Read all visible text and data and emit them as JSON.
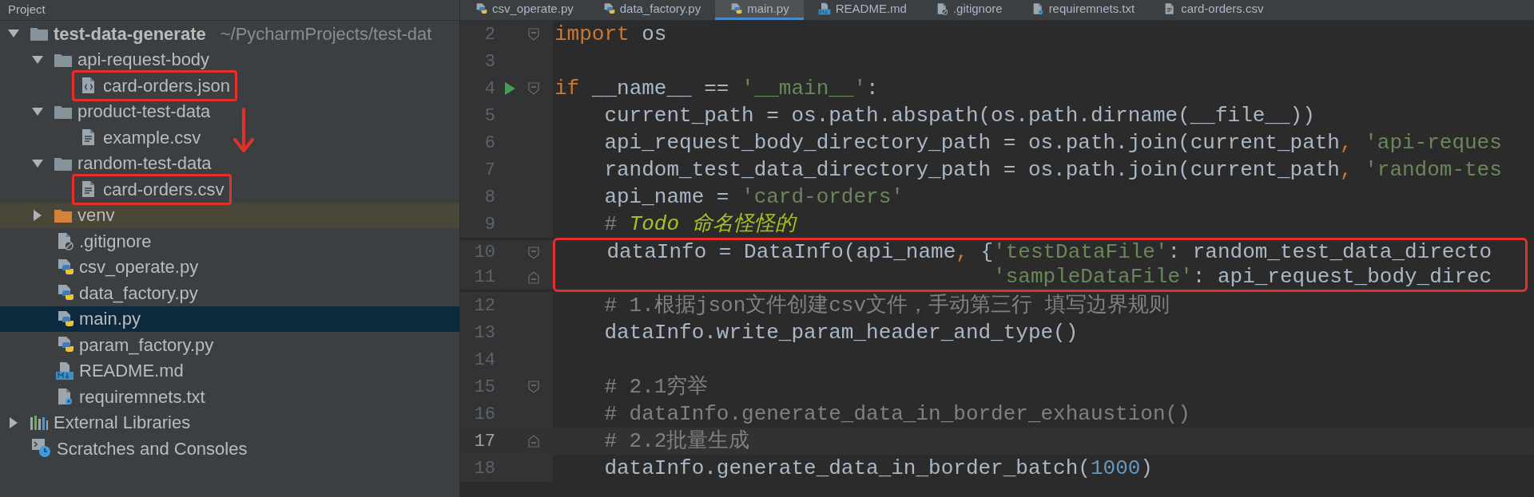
{
  "project_panel": {
    "title": "Project",
    "annotation_arrow": true,
    "tree": [
      {
        "name": "test-data-generate",
        "path": "~/PycharmProjects/test-dat",
        "kind": "folder",
        "expanded": true,
        "selected": false,
        "highlighted": false,
        "children": [
          {
            "name": "api-request-body",
            "kind": "folder",
            "expanded": true,
            "selected": false,
            "highlighted": false,
            "children": [
              {
                "name": "card-orders.json",
                "kind": "json",
                "selected": false,
                "highlighted": true
              }
            ]
          },
          {
            "name": "product-test-data",
            "kind": "folder",
            "expanded": true,
            "selected": false,
            "highlighted": false,
            "children": [
              {
                "name": "example.csv",
                "kind": "csv",
                "selected": false,
                "highlighted": false
              }
            ]
          },
          {
            "name": "random-test-data",
            "kind": "folder",
            "expanded": true,
            "selected": false,
            "highlighted": false,
            "children": [
              {
                "name": "card-orders.csv",
                "kind": "csv",
                "selected": false,
                "highlighted": true
              }
            ]
          },
          {
            "name": "venv",
            "kind": "excluded-folder",
            "expanded": false,
            "selected": false,
            "highlighted": false
          },
          {
            "name": ".gitignore",
            "kind": "gitignore",
            "selected": false,
            "highlighted": false
          },
          {
            "name": "csv_operate.py",
            "kind": "python",
            "selected": false,
            "highlighted": false
          },
          {
            "name": "data_factory.py",
            "kind": "python",
            "selected": false,
            "highlighted": false
          },
          {
            "name": "main.py",
            "kind": "python",
            "selected": true,
            "highlighted": false
          },
          {
            "name": "param_factory.py",
            "kind": "python",
            "selected": false,
            "highlighted": false
          },
          {
            "name": "README.md",
            "kind": "markdown",
            "selected": false,
            "highlighted": false
          },
          {
            "name": "requiremnets.txt",
            "kind": "text",
            "selected": false,
            "highlighted": false
          }
        ]
      },
      {
        "name": "External Libraries",
        "kind": "libraries",
        "expanded": false,
        "selected": false,
        "highlighted": false
      },
      {
        "name": "Scratches and Consoles",
        "kind": "scratches",
        "selected": false,
        "highlighted": false
      }
    ]
  },
  "editor": {
    "tabs": [
      {
        "label": "csv_operate.py",
        "kind": "python",
        "selected": false
      },
      {
        "label": "data_factory.py",
        "kind": "python",
        "selected": false
      },
      {
        "label": "main.py",
        "kind": "python",
        "selected": true
      },
      {
        "label": "README.md",
        "kind": "markdown",
        "selected": false
      },
      {
        "label": ".gitignore",
        "kind": "gitignore",
        "selected": false
      },
      {
        "label": "requiremnets.txt",
        "kind": "text",
        "selected": false
      },
      {
        "label": "card-orders.csv",
        "kind": "csv",
        "selected": false
      }
    ],
    "lines": [
      {
        "number": "2",
        "markers": [
          {
            "kind": "fold-start"
          }
        ],
        "current": false,
        "highlighted": false,
        "tokens": [
          {
            "kind": "keyword",
            "text": "import"
          },
          {
            "kind": "plain",
            "text": " os"
          }
        ]
      },
      {
        "number": "3",
        "current": false,
        "highlighted": false
      },
      {
        "number": "4",
        "markers": [
          {
            "kind": "run"
          },
          {
            "kind": "fold-start"
          }
        ],
        "current": false,
        "highlighted": false,
        "tokens": [
          {
            "kind": "keyword",
            "text": "if"
          },
          {
            "kind": "plain",
            "text": " __name__ == "
          },
          {
            "kind": "string",
            "text": "'__main__'"
          },
          {
            "kind": "plain",
            "text": ":"
          }
        ]
      },
      {
        "number": "5",
        "current": false,
        "highlighted": false,
        "tokens": [
          {
            "kind": "plain",
            "text": "    current_path = os.path.abspath(os.path.dirname(__file__))"
          }
        ]
      },
      {
        "number": "6",
        "current": false,
        "highlighted": false,
        "tokens": [
          {
            "kind": "plain",
            "text": "    api_request_body_directory_path = os.path.join(current_path"
          },
          {
            "kind": "keyword",
            "text": ", "
          },
          {
            "kind": "string",
            "text": "'api-reques"
          }
        ]
      },
      {
        "number": "7",
        "current": false,
        "highlighted": false,
        "tokens": [
          {
            "kind": "plain",
            "text": "    random_test_data_directory_path = os.path.join(current_path"
          },
          {
            "kind": "keyword",
            "text": ", "
          },
          {
            "kind": "string",
            "text": "'random-tes"
          }
        ]
      },
      {
        "number": "8",
        "current": false,
        "highlighted": false,
        "tokens": [
          {
            "kind": "plain",
            "text": "    api_name = "
          },
          {
            "kind": "string",
            "text": "'card-orders'"
          }
        ]
      },
      {
        "number": "9",
        "current": false,
        "highlighted": false,
        "tokens": [
          {
            "kind": "comment",
            "text": "    # "
          },
          {
            "kind": "todo",
            "text": "Todo 命名怪怪的"
          }
        ]
      },
      {
        "number": "10",
        "markers": [
          {
            "kind": "fold-start"
          }
        ],
        "current": false,
        "highlighted": true,
        "tokens": [
          {
            "kind": "plain",
            "text": "    dataInfo = DataInfo(api_name"
          },
          {
            "kind": "keyword",
            "text": ", "
          },
          {
            "kind": "plain",
            "text": "{"
          },
          {
            "kind": "string",
            "text": "'testDataFile'"
          },
          {
            "kind": "plain",
            "text": ": random_test_data_directo"
          }
        ]
      },
      {
        "number": "11",
        "markers": [
          {
            "kind": "fold-end"
          }
        ],
        "current": false,
        "highlighted": true,
        "tokens": [
          {
            "kind": "string",
            "text": "                                   'sampleDataFile'"
          },
          {
            "kind": "plain",
            "text": ": api_request_body_direc"
          }
        ]
      },
      {
        "number": "12",
        "current": false,
        "highlighted": false,
        "tokens": [
          {
            "kind": "comment",
            "text": "    # 1.根据json文件创建csv文件，手动第三行 填写边界规则"
          }
        ]
      },
      {
        "number": "13",
        "current": false,
        "highlighted": false,
        "tokens": [
          {
            "kind": "plain",
            "text": "    dataInfo.write_param_header_and_type()"
          }
        ]
      },
      {
        "number": "14",
        "current": false,
        "highlighted": false
      },
      {
        "number": "15",
        "markers": [
          {
            "kind": "fold-start"
          }
        ],
        "current": false,
        "highlighted": false,
        "tokens": [
          {
            "kind": "comment",
            "text": "    # 2.1穷举"
          }
        ]
      },
      {
        "number": "16",
        "current": false,
        "highlighted": false,
        "tokens": [
          {
            "kind": "comment",
            "text": "    # dataInfo.generate_data_in_border_exhaustion()"
          }
        ]
      },
      {
        "number": "17",
        "markers": [
          {
            "kind": "fold-end"
          }
        ],
        "current": true,
        "highlighted": false,
        "tokens": [
          {
            "kind": "comment",
            "text": "    # 2.2批量生成"
          }
        ]
      },
      {
        "number": "18",
        "current": false,
        "highlighted": false,
        "tokens": [
          {
            "kind": "plain",
            "text": "    dataInfo.generate_data_in_border_batch("
          },
          {
            "kind": "number",
            "text": "1000"
          },
          {
            "kind": "plain",
            "text": ")"
          }
        ]
      }
    ]
  }
}
